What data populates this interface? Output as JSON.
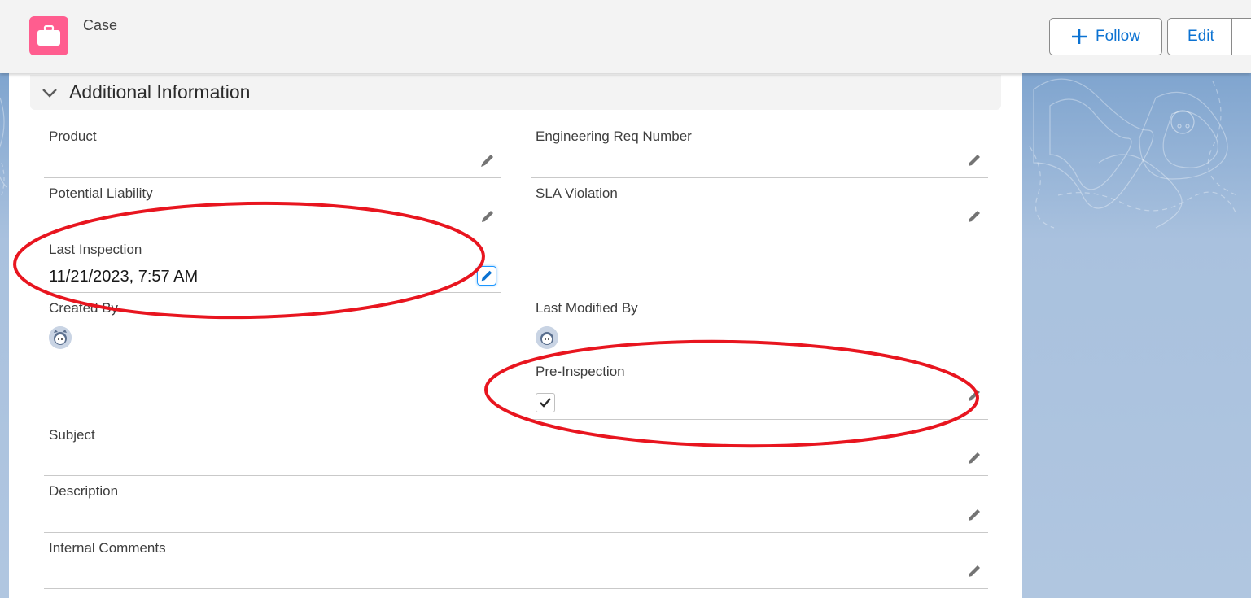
{
  "header": {
    "object_icon": "briefcase-icon",
    "object_label": "Case",
    "follow_button": {
      "icon": "plus-icon",
      "label": "Follow"
    },
    "edit_button": {
      "label": "Edit"
    }
  },
  "section": {
    "toggle_icon": "chevron-down-icon",
    "title": "Additional Information"
  },
  "fields": {
    "product": {
      "label": "Product",
      "value": ""
    },
    "engineering_req_number": {
      "label": "Engineering Req Number",
      "value": ""
    },
    "potential_liability": {
      "label": "Potential Liability",
      "value": ""
    },
    "sla_violation": {
      "label": "SLA Violation",
      "value": ""
    },
    "last_inspection": {
      "label": "Last Inspection",
      "value": "11/21/2023, 7:57 AM"
    },
    "created_by": {
      "label": "Created By",
      "avatar": "user-avatar"
    },
    "last_modified_by": {
      "label": "Last Modified By",
      "avatar": "user-avatar"
    },
    "pre_inspection": {
      "label": "Pre-Inspection",
      "checked": true
    },
    "subject": {
      "label": "Subject",
      "value": ""
    },
    "description": {
      "label": "Description",
      "value": ""
    },
    "internal_comments": {
      "label": "Internal Comments",
      "value": ""
    }
  },
  "colors": {
    "brand_icon": "#ff5d8f",
    "link_blue": "#0b72d2",
    "annotation_red": "#e8151f"
  }
}
